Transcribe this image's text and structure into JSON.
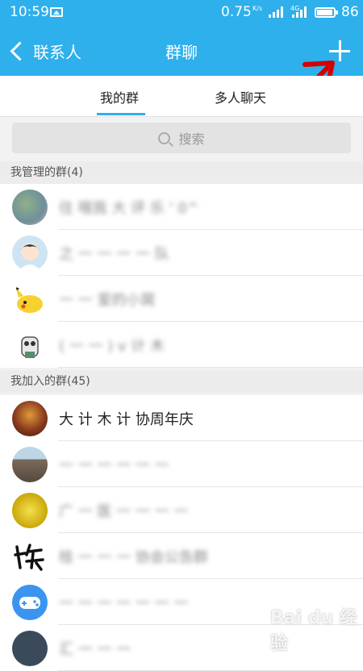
{
  "status_bar": {
    "time": "10:59",
    "speed": "0.75",
    "speed_unit": "K/s",
    "network": "4G",
    "battery": "86"
  },
  "navbar": {
    "back_label": "联系人",
    "title": "群聊"
  },
  "tabs": [
    {
      "label": "我的群",
      "active": true
    },
    {
      "label": "多人聊天",
      "active": false
    }
  ],
  "search": {
    "placeholder": "搜索"
  },
  "sections": [
    {
      "header": "我管理的群(4)",
      "groups": [
        {
          "name": "往 哦我 大 评 乐 ' 0^",
          "icon": "group-photo-icon"
        },
        {
          "name": "之 一 一 一 一 队",
          "icon": "girl-cartoon-icon"
        },
        {
          "name": "一 一 爱的小窝",
          "icon": "pikachu-icon"
        },
        {
          "name": "( 一 一 ) v 计 木",
          "icon": "panda-cartoon-icon"
        }
      ]
    },
    {
      "header": "我加入的群(45)",
      "groups": [
        {
          "name": "大 计 木 计 协周年庆",
          "icon": "stage-photo-icon"
        },
        {
          "name": "一 一 一 一 一 一",
          "icon": "building-photo-icon"
        },
        {
          "name": "广 一 医 一 一 一 一",
          "icon": "gold-badge-icon"
        },
        {
          "name": "桂 一 一 一 协会公告群",
          "icon": "calligraphy-icon"
        },
        {
          "name": "一 一 一 一 一 一 一",
          "icon": "gamepad-icon"
        },
        {
          "name": "汇 一 一 一",
          "icon": "dark-avatar-icon"
        }
      ]
    }
  ],
  "watermark": "Bai du 经验",
  "colors": {
    "accent": "#2db0ec",
    "annotation": "#d40000"
  }
}
